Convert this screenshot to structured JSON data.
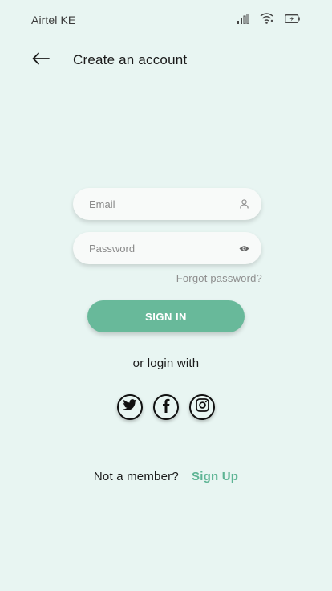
{
  "status_bar": {
    "carrier": "Airtel KE",
    "icons": [
      "signal-icon",
      "wifi-icon",
      "battery-icon"
    ]
  },
  "header": {
    "back_icon": "arrow-left-icon",
    "title": "Create an account"
  },
  "form": {
    "email": {
      "placeholder": "Email",
      "value": "",
      "icon": "user-icon"
    },
    "password": {
      "placeholder": "Password",
      "value": "",
      "icon": "eye-icon"
    },
    "forgot_label": "Forgot password?",
    "signin_label": "SIGN IN"
  },
  "social": {
    "prompt": "or login with",
    "providers": [
      "twitter-icon",
      "facebook-icon",
      "instagram-icon"
    ]
  },
  "footer": {
    "member_text": "Not a member?",
    "signup_label": "Sign Up"
  },
  "colors": {
    "background": "#e8f5f2",
    "accent": "#68b99a",
    "link": "#5db494"
  }
}
